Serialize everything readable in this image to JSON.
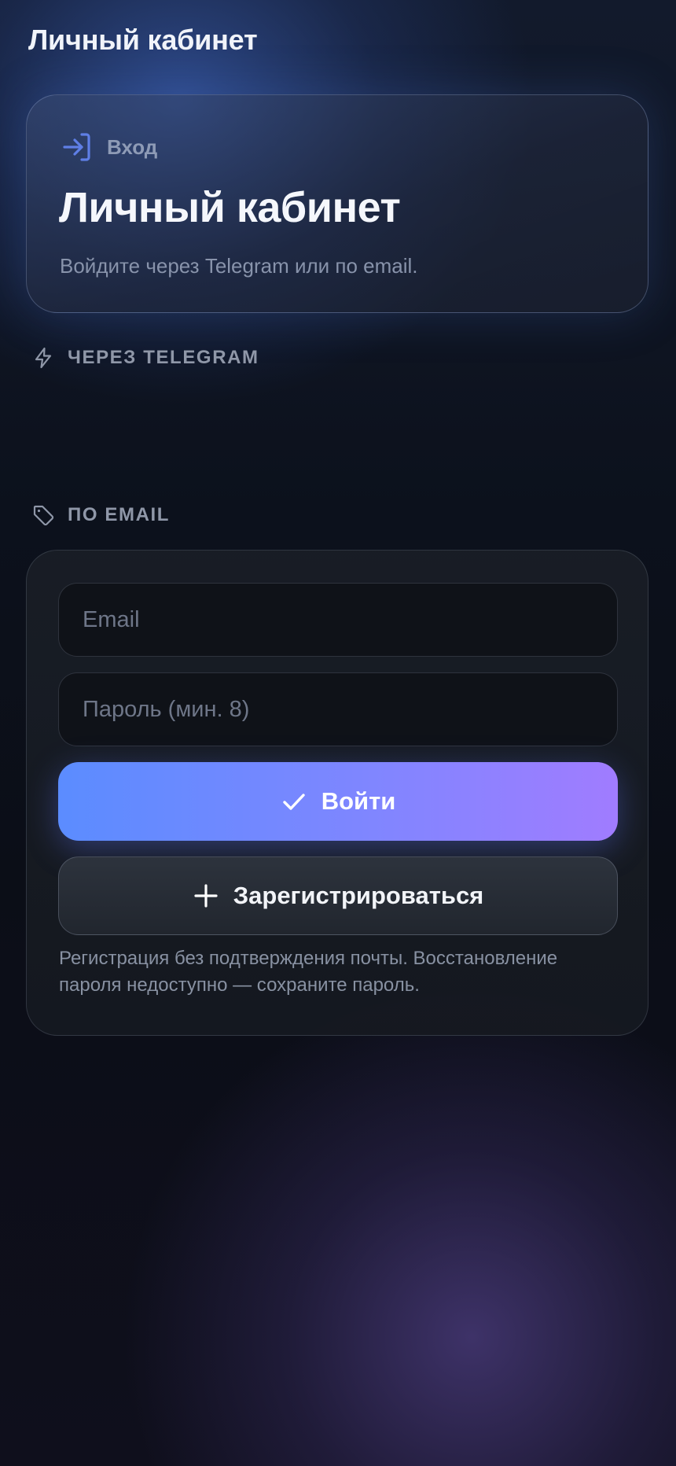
{
  "header": {
    "title": "Личный кабинет"
  },
  "hero": {
    "eyebrow_icon": "login-icon",
    "eyebrow": "Вход",
    "title": "Личный кабинет",
    "subtitle": "Войдите через Telegram или по email."
  },
  "telegram_section": {
    "icon": "lightning-icon",
    "label": "ЧЕРЕЗ TELEGRAM"
  },
  "email_section": {
    "icon": "tag-icon",
    "label": "ПО EMAIL",
    "email_placeholder": "Email",
    "password_placeholder": "Пароль (мин. 8)",
    "login_icon": "check-icon",
    "login_label": "Войти",
    "register_icon": "plus-icon",
    "register_label": "Зарегистрироваться",
    "note": "Регистрация без подтверждения почты. Восстановление пароля недоступно — сохраните пароль."
  },
  "colors": {
    "accent_start": "#5b8cff",
    "accent_end": "#a07cff",
    "icon_accent": "#5f7fe6",
    "background": "#0b0e17"
  }
}
